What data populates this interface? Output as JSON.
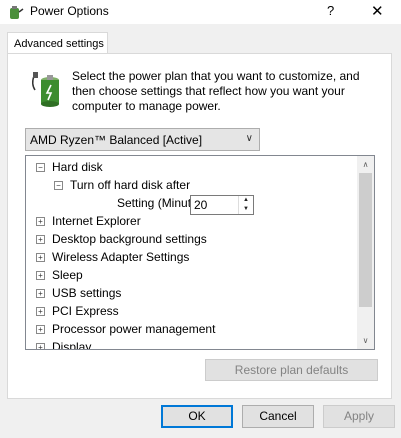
{
  "window": {
    "title": "Power Options",
    "help_glyph": "?",
    "close_glyph": "✕"
  },
  "tab": {
    "label": "Advanced settings"
  },
  "description": "Select the power plan that you want to customize, and then choose settings that reflect how you want your computer to manage power.",
  "plan_select": {
    "value": "AMD Ryzen™ Balanced [Active]"
  },
  "tree": {
    "hard_disk": {
      "label": "Hard disk",
      "expander": "−"
    },
    "turn_off": {
      "label": "Turn off hard disk after",
      "expander": "−"
    },
    "setting": {
      "label": "Setting (Minutes):",
      "value": "20"
    },
    "items": [
      {
        "label": "Internet Explorer",
        "expander": "+"
      },
      {
        "label": "Desktop background settings",
        "expander": "+"
      },
      {
        "label": "Wireless Adapter Settings",
        "expander": "+"
      },
      {
        "label": "Sleep",
        "expander": "+"
      },
      {
        "label": "USB settings",
        "expander": "+"
      },
      {
        "label": "PCI Express",
        "expander": "+"
      },
      {
        "label": "Processor power management",
        "expander": "+"
      },
      {
        "label": "Display",
        "expander": "+"
      }
    ]
  },
  "buttons": {
    "restore": "Restore plan defaults",
    "ok": "OK",
    "cancel": "Cancel",
    "apply": "Apply"
  },
  "icons": {
    "app": "power-options-icon",
    "battery": "battery-plug-icon"
  }
}
